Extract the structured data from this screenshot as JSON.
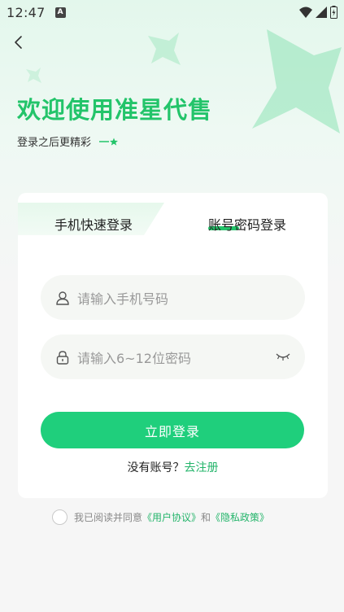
{
  "status_bar": {
    "time": "12:47",
    "notification_letter": "A"
  },
  "header": {
    "title": "欢迎使用准星代售",
    "subtitle": "登录之后更精彩"
  },
  "tabs": {
    "phone_login": "手机快速登录",
    "password_login": "账号密码登录"
  },
  "form": {
    "phone_placeholder": "请输入手机号码",
    "password_placeholder": "请输入6~12位密码"
  },
  "actions": {
    "login_label": "立即登录",
    "no_account": "没有账号？",
    "register_link": "去注册"
  },
  "agreement": {
    "prefix": "我已阅读并同意",
    "user_agreement": "《用户协议》",
    "and": "和",
    "privacy_policy": "《隐私政策》"
  },
  "colors": {
    "accent": "#23c46a",
    "button": "#1fcf7c"
  }
}
